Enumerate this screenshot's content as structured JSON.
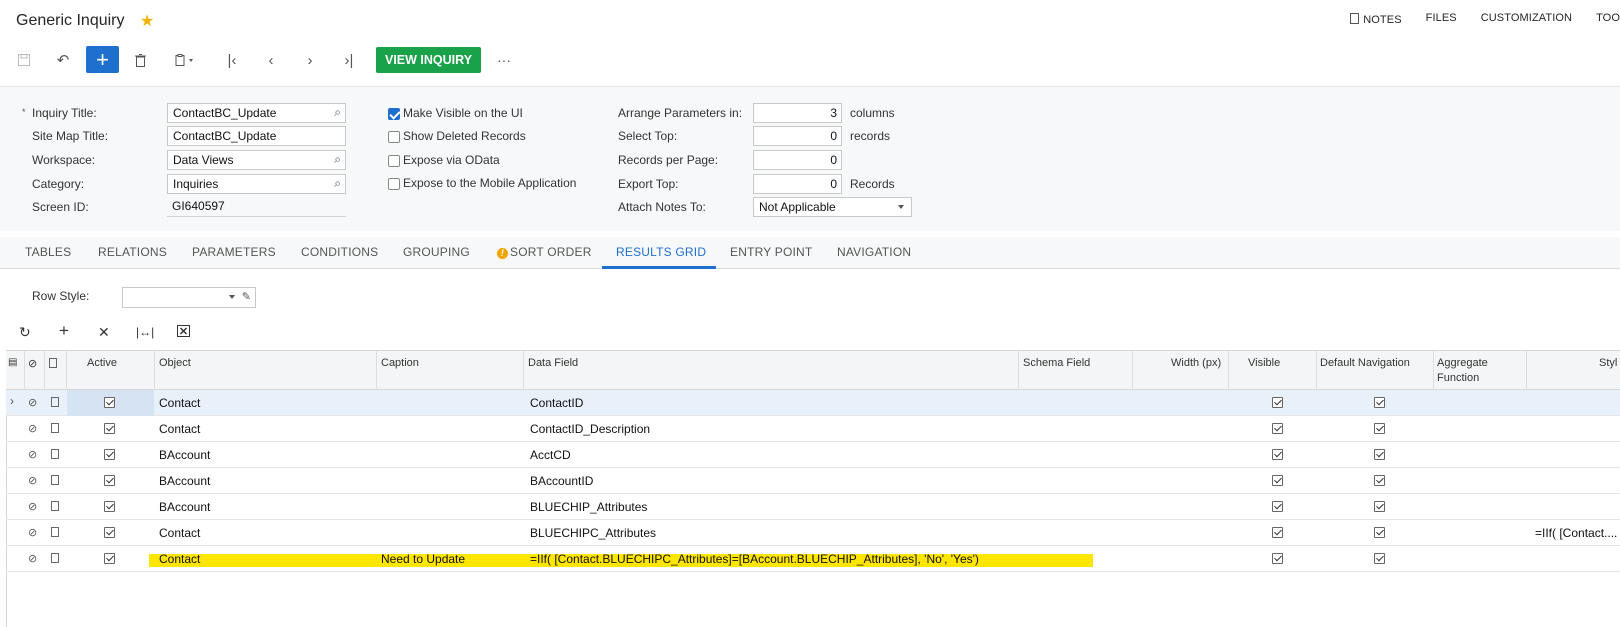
{
  "header": {
    "title": "Generic Inquiry",
    "links": [
      "NOTES",
      "FILES",
      "CUSTOMIZATION",
      "TOO"
    ]
  },
  "toolbar": {
    "view_inquiry": "VIEW INQUIRY",
    "more": "···"
  },
  "form": {
    "inquiry_title_label": "Inquiry Title:",
    "inquiry_title_value": "ContactBC_Update",
    "site_map_title_label": "Site Map Title:",
    "site_map_title_value": "ContactBC_Update",
    "workspace_label": "Workspace:",
    "workspace_value": "Data Views",
    "category_label": "Category:",
    "category_value": "Inquiries",
    "screen_id_label": "Screen ID:",
    "screen_id_value": "GI640597",
    "make_visible_label": "Make Visible on the UI",
    "show_deleted_label": "Show Deleted Records",
    "expose_odata_label": "Expose via OData",
    "expose_mobile_label": "Expose to the Mobile Application",
    "arrange_label": "Arrange Parameters in:",
    "arrange_value": "3",
    "arrange_unit": "columns",
    "select_top_label": "Select Top:",
    "select_top_value": "0",
    "select_top_unit": "records",
    "records_per_page_label": "Records per Page:",
    "records_per_page_value": "0",
    "export_top_label": "Export Top:",
    "export_top_value": "0",
    "export_top_unit": "Records",
    "attach_notes_label": "Attach Notes To:",
    "attach_notes_value": "Not Applicable"
  },
  "tabs": [
    "TABLES",
    "RELATIONS",
    "PARAMETERS",
    "CONDITIONS",
    "GROUPING",
    "SORT ORDER",
    "RESULTS GRID",
    "ENTRY POINT",
    "NAVIGATION"
  ],
  "grid": {
    "row_style_label": "Row Style:",
    "columns": [
      "Active",
      "Object",
      "Caption",
      "Data Field",
      "Schema Field",
      "Width (px)",
      "Visible",
      "Default Navigation",
      "Aggregate",
      "Function",
      "Styl"
    ],
    "rows": [
      {
        "object": "Contact",
        "caption": "",
        "data_field": "ContactID",
        "style": ""
      },
      {
        "object": "Contact",
        "caption": "",
        "data_field": "ContactID_Description",
        "style": ""
      },
      {
        "object": "BAccount",
        "caption": "",
        "data_field": "AcctCD",
        "style": ""
      },
      {
        "object": "BAccount",
        "caption": "",
        "data_field": "BAccountID",
        "style": ""
      },
      {
        "object": "BAccount",
        "caption": "",
        "data_field": "BLUECHIP_Attributes",
        "style": ""
      },
      {
        "object": "Contact",
        "caption": "",
        "data_field": "BLUECHIPC_Attributes",
        "style": "=IIf( [Contact...."
      },
      {
        "object": "Contact",
        "caption": "Need to Update",
        "data_field": "=IIf( [Contact.BLUECHIPC_Attributes]=[BAccount.BLUECHIP_Attributes], 'No', 'Yes')",
        "style": ""
      }
    ]
  },
  "colors": {
    "accent": "#1f6fcf",
    "view_inquiry": "#1aa24a",
    "highlight": "#ffe600",
    "star": "#f0b400"
  }
}
